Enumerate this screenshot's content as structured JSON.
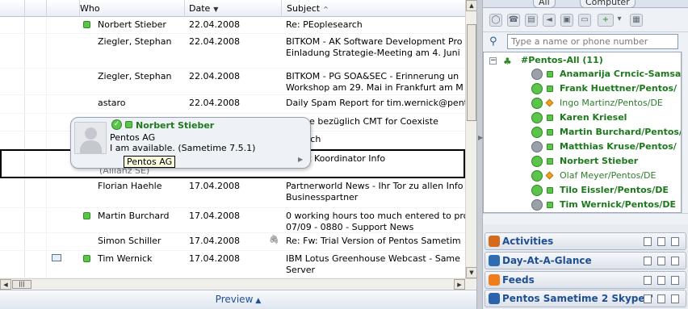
{
  "mail_list": {
    "headers": {
      "who": "Who",
      "date": "Date",
      "subject": "Subject"
    },
    "rows": [
      {
        "who": "Norbert Stieber",
        "date": "22.04.2008",
        "subject": [
          "Re: PEoplesearch"
        ],
        "online": true
      },
      {
        "who": "Ziegler, Stephan",
        "date": "22.04.2008",
        "subject": [
          "BITKOM - AK Software Development Pro",
          "Einladung Strategie-Meeting am 4. Juni"
        ],
        "online": false
      },
      {
        "who": "Ziegler, Stephan",
        "date": "22.04.2008",
        "subject": [
          "BITKOM - PG SOA&SEC - Erinnerung un",
          "Workshop am 29. Mai in Frankfurt am M"
        ],
        "online": false
      },
      {
        "who": "astaro",
        "date": "22.04.2008",
        "subject": [
          "Daily Spam Report for tim.wernick@pent"
        ],
        "online": false
      },
      {
        "who": "",
        "date": "",
        "subject": [
          "nfrage bezüglich CMT for Coexiste"
        ],
        "online": false
      },
      {
        "who": "",
        "date": "",
        "subject": [
          "esearch"
        ],
        "online": false
      },
      {
        "who": "(Allianz SE)",
        "date": "",
        "subject": [
          "nport Koordinator Info"
        ],
        "online": false
      },
      {
        "who": "Florian Haehle",
        "date": "17.04.2008",
        "subject": [
          "Partnerworld News - Ihr Tor zu allen Info",
          "Businesspartner"
        ],
        "online": false
      },
      {
        "who": "Martin Burchard",
        "date": "17.04.2008",
        "subject": [
          "0 working hours too much entered to pro",
          "07/09 - 0880 - Support News"
        ],
        "online": true
      },
      {
        "who": "Simon Schiller",
        "date": "17.04.2008",
        "subject": [
          "Re: Fw: Trial Version of Pentos Sametim"
        ],
        "online": false
      },
      {
        "who": "Tim Wernick",
        "date": "17.04.2008",
        "subject": [
          "IBM Lotus Greenhouse Webcast - Same",
          "Server"
        ],
        "online": true
      }
    ],
    "preview_label": "Preview"
  },
  "bizcard": {
    "name": "Norbert Stieber",
    "company": "Pentos AG",
    "status": "I am available.  (Sametime 7.5.1)",
    "tooltip": "Pentos AG"
  },
  "sidebar": {
    "tabs": [
      "All",
      "Computer"
    ],
    "search_placeholder": "Type a name or phone number",
    "group": "#Pentos-All (11)",
    "contacts": [
      {
        "name": "Anamarija Crncic-Samsa",
        "status": "offline",
        "bold": true
      },
      {
        "name": "Frank Huettner/Pentos/",
        "status": "available",
        "bold": true
      },
      {
        "name": "Ingo Martinz/Pentos/DE",
        "status": "phone",
        "bold": false
      },
      {
        "name": "Karen Kriesel",
        "status": "available",
        "bold": true
      },
      {
        "name": "Martin Burchard/Pentos/",
        "status": "available",
        "bold": true
      },
      {
        "name": "Matthias Kruse/Pentos/",
        "status": "offline",
        "bold": true
      },
      {
        "name": "Norbert Stieber",
        "status": "available",
        "bold": true
      },
      {
        "name": "Olaf Meyer/Pentos/DE",
        "status": "phone",
        "bold": false
      },
      {
        "name": "Tilo Eissler/Pentos/DE",
        "status": "available",
        "bold": true
      },
      {
        "name": "Tim Wernick/Pentos/DE",
        "status": "offline",
        "bold": true
      }
    ],
    "sections": [
      {
        "title": "Activities",
        "color": "#d46a1c"
      },
      {
        "title": "Day-At-A-Glance",
        "color": "#2f6db3"
      },
      {
        "title": "Feeds",
        "color": "#ef7d1a"
      },
      {
        "title": "Pentos Sametime 2 Skype™",
        "color": "#2a63b0"
      }
    ]
  }
}
